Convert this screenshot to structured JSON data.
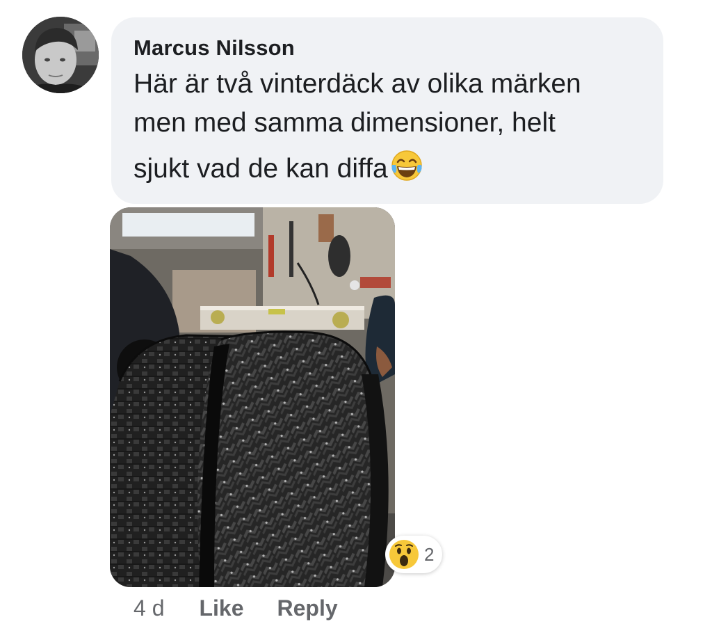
{
  "comment": {
    "author": "Marcus Nilsson",
    "text_lines": [
      "Här är två vinterdäck av olika märken",
      "men med samma dimensioner, helt",
      "sjukt vad de kan diffa"
    ],
    "emoji": "face-with-tears-of-joy-icon"
  },
  "reactions": {
    "icon": "wow-reaction-icon",
    "count": "2"
  },
  "actions": {
    "timestamp": "4 d",
    "like_label": "Like",
    "reply_label": "Reply"
  },
  "colors": {
    "bubble_background": "#f0f2f5",
    "text": "#1c1e21",
    "secondary_text": "#65676b"
  }
}
